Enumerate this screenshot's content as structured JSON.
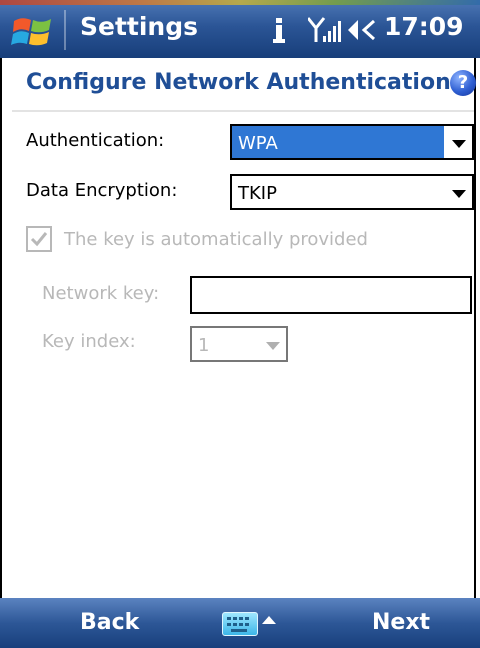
{
  "titlebar": {
    "app_title": "Settings",
    "icons": [
      "windows-start-icon",
      "connectivity-icon",
      "signal-icon",
      "volume-icon"
    ],
    "time": "17:09"
  },
  "page": {
    "heading": "Configure Network Authentication",
    "help_label": "?"
  },
  "form": {
    "authentication_label": "Authentication:",
    "authentication_value": "WPA",
    "data_encryption_label": "Data Encryption:",
    "data_encryption_value": "TKIP",
    "auto_key_label": "The key is automatically provided",
    "auto_key_checked": true,
    "network_key_label": "Network key:",
    "network_key_value": "",
    "key_index_label": "Key index:",
    "key_index_value": "1"
  },
  "bottombar": {
    "left_softkey": "Back",
    "right_softkey": "Next",
    "center_icon": "keyboard-icon"
  },
  "colors": {
    "heading": "#1f4e96",
    "selection": "#2f77d4",
    "disabled_text": "#b8b8b8"
  }
}
